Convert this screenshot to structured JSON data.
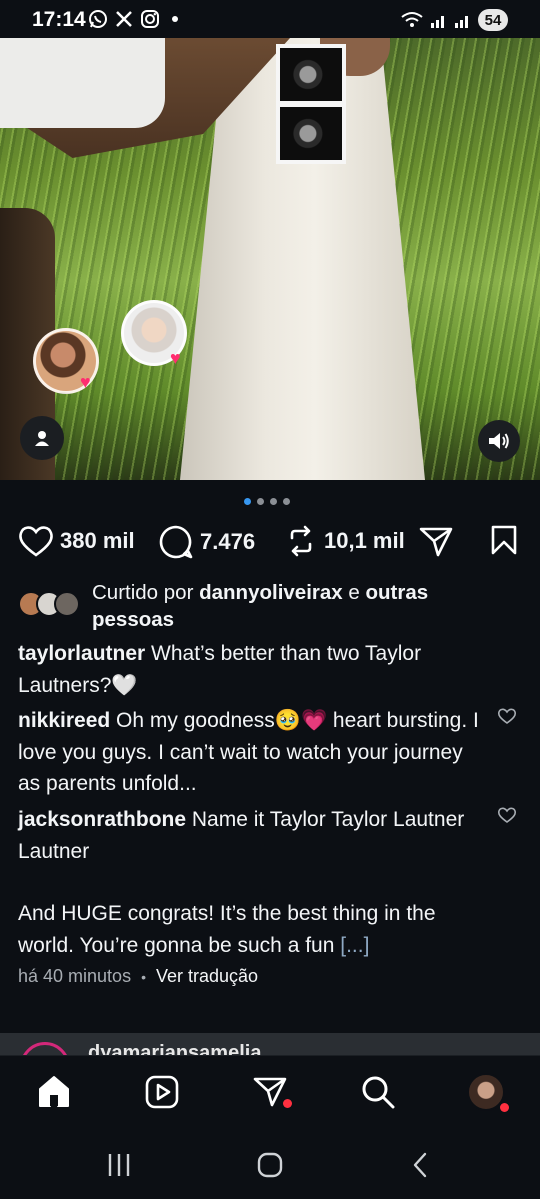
{
  "status_bar": {
    "time": "17:14",
    "notification_icons": [
      "whatsapp-icon",
      "x-icon",
      "instagram-icon"
    ],
    "battery": "54"
  },
  "post": {
    "carousel": {
      "count": 4,
      "active_index": 0
    },
    "stats": {
      "likes": "380 mil",
      "comments": "7.476",
      "reposts": "10,1 mil"
    },
    "liked_by": {
      "prefix": "Curtido por ",
      "user": "dannyoliveirax",
      "connector": " e ",
      "others": "outras pessoas"
    },
    "caption": {
      "user": "taylorlautner",
      "text": " What’s better than two Taylor Lautners?🤍"
    },
    "comments_preview": [
      {
        "user": "nikkireed",
        "text": " Oh my goodness🥹💗 heart bursting. I love you guys. I can’t wait to watch your journey as parents unfold..."
      },
      {
        "user": "jacksonrathbone",
        "text": " Name it Taylor Taylor Lautner Lautner",
        "text2": "And HUGE congrats!  It’s the best thing in the world.  You’re gonna be such a fun ",
        "more": "[...]"
      }
    ],
    "time_ago": "há 40 minutos",
    "separator": "•",
    "translate_label": "Ver tradução"
  },
  "next_post": {
    "username": "dyamariansamelia"
  },
  "bottom_nav": {
    "items": [
      "home-icon",
      "reels-icon",
      "direct-icon",
      "search-icon",
      "profile-avatar"
    ]
  },
  "colors": {
    "background": "#0c0f14",
    "accent_blue": "#3797f0",
    "notification_red": "#ff3040",
    "text": "#f3f5f7",
    "muted": "#a8adb3"
  }
}
